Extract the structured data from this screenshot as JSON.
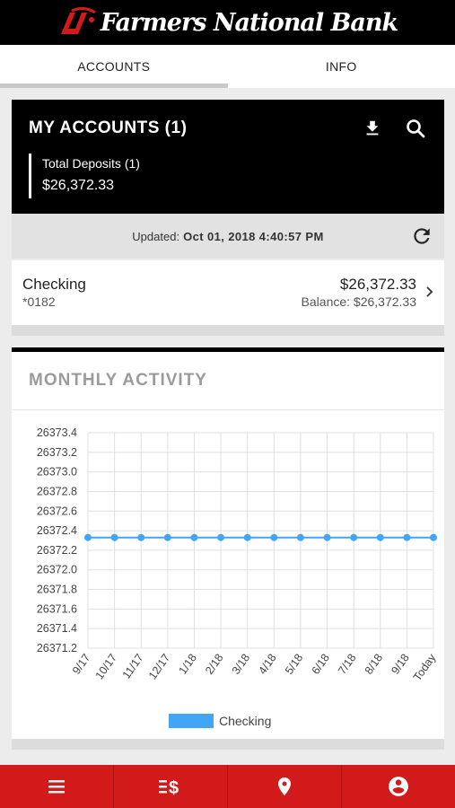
{
  "app": {
    "brand_name": "Farmers National Bank",
    "brand_color": "#d31a1a"
  },
  "tabs": [
    {
      "label": "ACCOUNTS",
      "active": true
    },
    {
      "label": "INFO",
      "active": false
    }
  ],
  "accounts": {
    "title": "MY ACCOUNTS (1)",
    "total_label": "Total Deposits (1)",
    "total_amount": "$26,372.33",
    "download_icon": "download-icon",
    "search_icon": "search-icon"
  },
  "updated": {
    "label": "Updated:",
    "value": "Oct 01, 2018 4:40:57 PM",
    "refresh_icon": "refresh-icon"
  },
  "account_list": [
    {
      "name": "Checking",
      "number": "*0182",
      "amount": "$26,372.33",
      "balance": "Balance: $26,372.33"
    }
  ],
  "activity": {
    "title": "MONTHLY ACTIVITY"
  },
  "chart_data": {
    "type": "line",
    "title": "",
    "xlabel": "",
    "ylabel": "",
    "categories": [
      "9/17",
      "10/17",
      "11/17",
      "12/17",
      "1/18",
      "2/18",
      "3/18",
      "4/18",
      "5/18",
      "6/18",
      "7/18",
      "8/18",
      "9/18",
      "Today"
    ],
    "ylim": [
      26371.2,
      26373.4
    ],
    "yticks": [
      "26373.4",
      "26373.2",
      "26373.0",
      "26372.8",
      "26372.6",
      "26372.4",
      "26372.2",
      "26372.0",
      "26371.8",
      "26371.6",
      "26371.4",
      "26371.2"
    ],
    "series": [
      {
        "name": "Checking",
        "color": "#42a5f5",
        "values": [
          26372.33,
          26372.33,
          26372.33,
          26372.33,
          26372.33,
          26372.33,
          26372.33,
          26372.33,
          26372.33,
          26372.33,
          26372.33,
          26372.33,
          26372.33,
          26372.33
        ]
      }
    ],
    "grid": true,
    "legend": "bottom"
  },
  "bottom_nav": [
    {
      "icon": "menu-icon"
    },
    {
      "icon": "transfer-money-icon"
    },
    {
      "icon": "location-pin-icon"
    },
    {
      "icon": "account-circle-icon"
    }
  ]
}
